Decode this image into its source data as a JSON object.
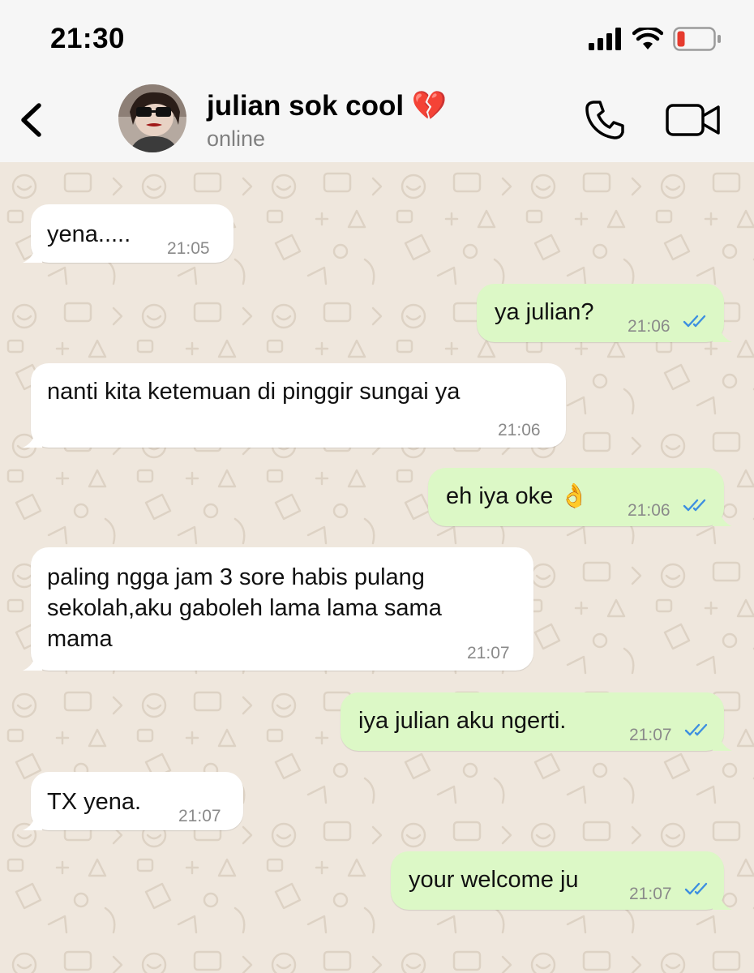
{
  "status_bar": {
    "time": "21:30"
  },
  "header": {
    "contact_name": "julian sok cool 💔",
    "contact_status": "online"
  },
  "messages": [
    {
      "direction": "incoming",
      "text": "yena.....",
      "time": "21:05"
    },
    {
      "direction": "outgoing",
      "text": "ya julian?",
      "time": "21:06",
      "read": true
    },
    {
      "direction": "incoming",
      "text": "nanti kita ketemuan di pinggir sungai ya",
      "time": "21:06"
    },
    {
      "direction": "outgoing",
      "text": "eh iya oke 👌",
      "time": "21:06",
      "read": true
    },
    {
      "direction": "incoming",
      "lines": [
        "paling ngga jam 3 sore habis pulang",
        "sekolah,aku gaboleh lama lama sama",
        "mama"
      ],
      "time": "21:07"
    },
    {
      "direction": "outgoing",
      "text": "iya julian aku ngerti.",
      "time": "21:07",
      "read": true
    },
    {
      "direction": "incoming",
      "text": "TX yena.",
      "time": "21:07"
    },
    {
      "direction": "outgoing",
      "text": "your welcome ju",
      "time": "21:07",
      "read": true
    }
  ],
  "colors": {
    "incoming_bubble": "#ffffff",
    "outgoing_bubble": "#dcf8c6",
    "read_ticks": "#3d8fe0",
    "battery_low": "#e63b2e",
    "wallpaper": "#efe7dd"
  },
  "icons": [
    "signal-icon",
    "wifi-icon",
    "battery-icon",
    "back-chevron-icon",
    "phone-icon",
    "video-camera-icon",
    "double-check-icon"
  ]
}
